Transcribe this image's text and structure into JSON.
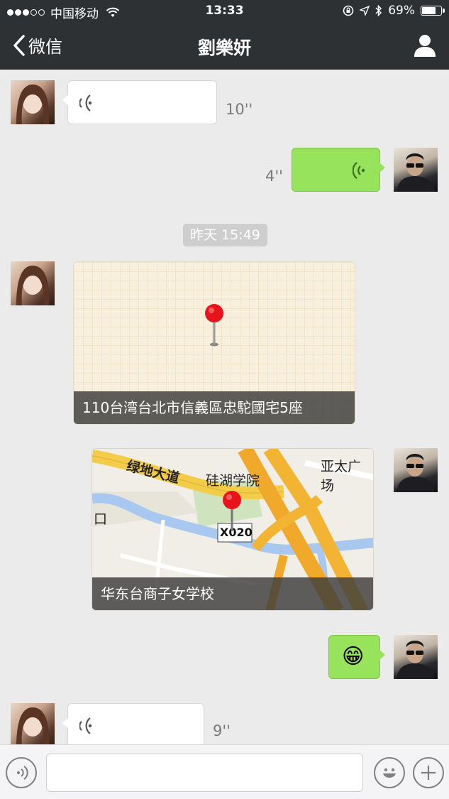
{
  "status_bar": {
    "carrier": "中国移动",
    "time": "13:33",
    "battery_percent": "69%",
    "battery_level": 0.69,
    "signal_icon": "signal-dots-icon",
    "wifi_icon": "wifi-icon"
  },
  "nav": {
    "back_label": "微信",
    "title": "劉樂妍",
    "contact_icon": "person-icon"
  },
  "messages": [
    {
      "type": "voice",
      "direction": "incoming",
      "duration": "10''"
    },
    {
      "type": "voice",
      "direction": "outgoing",
      "duration": "4''"
    },
    {
      "type": "timestamp",
      "text": "昨天 15:49"
    },
    {
      "type": "location",
      "direction": "incoming",
      "address": "110台湾台北市信義區忠駝國宅5座"
    },
    {
      "type": "location",
      "direction": "outgoing",
      "address": "华东台商子女学校",
      "map_labels": {
        "road": "绿地大道",
        "poi": "硅湖学院",
        "mall": "亚太广场",
        "marker": "X020",
        "edge": "口"
      }
    },
    {
      "type": "emoji",
      "direction": "outgoing",
      "emoji": "😁"
    },
    {
      "type": "voice",
      "direction": "incoming",
      "duration": "9''"
    }
  ],
  "input_bar": {
    "voice_icon": "voice-mode-icon",
    "text_value": "",
    "emoji_icon": "emoji-icon",
    "plus_icon": "plus-icon"
  },
  "colors": {
    "header_bg": "#2e3134",
    "chat_bg": "#ebebeb",
    "outgoing_bubble": "#97e35b",
    "incoming_bubble": "#ffffff"
  }
}
